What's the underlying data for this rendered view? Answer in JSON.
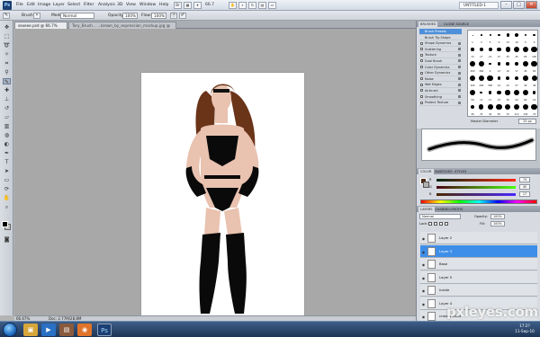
{
  "menubar": {
    "app_logo": "Ps",
    "items": [
      "File",
      "Edit",
      "Image",
      "Layer",
      "Select",
      "Filter",
      "Analysis",
      "3D",
      "View",
      "Window",
      "Help"
    ],
    "zoom": "66.7",
    "workspace": "UNTITLED-1",
    "window_controls": [
      "–",
      "□",
      "✕"
    ]
  },
  "options": {
    "brush_label": "Brush:",
    "mode_label": "Mode:",
    "mode_value": "Normal",
    "opacity_label": "Opacity:",
    "opacity_value": "100%",
    "flow_label": "Flow:",
    "flow_value": "100%"
  },
  "tabs": [
    {
      "label": "sexeee.psd @ 66.7% (Layer 3, RGB/8#) *",
      "active": true
    },
    {
      "label": "Tory_Brush...  ...brown_by_expression_mockup.jpg @ 66.7% (RGB/8#)",
      "active": false
    }
  ],
  "status": {
    "zoom": "66.67%",
    "doc": "Doc: 2.77M/28.8M"
  },
  "brushes_panel": {
    "tabs": [
      "BRUSHES",
      "CLONE SOURCE"
    ],
    "items": [
      "Brush Presets",
      "Brush Tip Shape",
      "Shape Dynamics",
      "Scattering",
      "Texture",
      "Dual Brush",
      "Color Dynamics",
      "Other Dynamics",
      "Noise",
      "Wet Edges",
      "Airbrush",
      "Smoothing",
      "Protect Texture"
    ],
    "grid_labels": [
      "1",
      "3",
      "5",
      "9",
      "13",
      "19",
      "5",
      "9",
      "13",
      "17",
      "21",
      "27",
      "35",
      "45",
      "65",
      "100",
      "200",
      "300",
      "9",
      "13",
      "19",
      "17",
      "45",
      "65",
      "100",
      "200",
      "300",
      "14",
      "24",
      "27",
      "39",
      "46",
      "59",
      "11",
      "17",
      "23",
      "36",
      "44",
      "60",
      "14",
      "26",
      "33",
      "42",
      "55",
      "70",
      "112",
      "134",
      "74"
    ],
    "master_label": "Master Diameter",
    "master_value": "25 px"
  },
  "color_panel": {
    "tabs": [
      "COLOR",
      "SWATCHES",
      "STYLES"
    ],
    "rows": [
      {
        "label": "R",
        "value": "74"
      },
      {
        "label": "G",
        "value": "40"
      },
      {
        "label": "B",
        "value": "17"
      }
    ]
  },
  "layers_panel": {
    "tabs": [
      "LAYERS",
      "CHANNELS",
      "PATHS"
    ],
    "blend": "Normal",
    "opacity_label": "Opacity:",
    "opacity": "100%",
    "lock_label": "Lock:",
    "fill_label": "Fill:",
    "fill": "100%",
    "layers": [
      {
        "name": "Layer 2",
        "selected": false
      },
      {
        "name": "Layer 3",
        "selected": true
      },
      {
        "name": "Base",
        "selected": false
      },
      {
        "name": "Layer 5",
        "selected": false
      },
      {
        "name": "Inside",
        "selected": false
      },
      {
        "name": "Layer 4",
        "selected": false
      },
      {
        "name": "cross x ollies",
        "selected": false
      }
    ]
  },
  "taskbar": {
    "apps": [
      "explorer-icon",
      "media-player-icon",
      "firefox-icon",
      "folder-icon",
      "photoshop-icon"
    ],
    "time": "17:2?",
    "date": "11-Sep-10"
  },
  "watermark": "pxleyes.com",
  "colors": {
    "accent": "#3d8ee8",
    "skin": "#e9c2b0",
    "hair": "#6a3419"
  }
}
